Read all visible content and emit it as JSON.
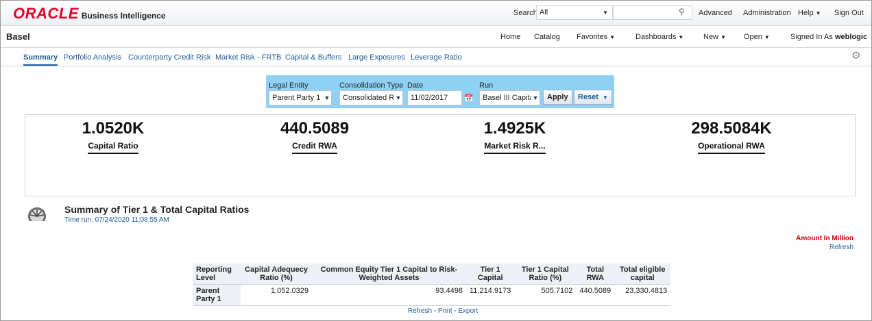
{
  "header": {
    "logo": "ORACLE",
    "product": "Business Intelligence",
    "search_label": "Search",
    "search_scope": "All",
    "search_value": "",
    "links": [
      "Advanced",
      "Administration",
      "Help",
      "Sign Out"
    ]
  },
  "nav": {
    "dashboard_title": "Basel",
    "items": [
      "Home",
      "Catalog",
      "Favorites",
      "Dashboards",
      "New",
      "Open"
    ],
    "signed_in_label": "Signed In As",
    "user": "weblogic"
  },
  "tabs": [
    "Summary",
    "Portfolio Analysis",
    "Counterparty Credit Risk",
    "Market Risk - FRTB",
    "Capital & Buffers",
    "Large Exposures",
    "Leverage Ratio"
  ],
  "active_tab": "Summary",
  "prompts": {
    "legal_entity": {
      "label": "Legal Entity",
      "value": "Parent Party 1"
    },
    "consolidation_type": {
      "label": "Consolidation Type",
      "value": "Consolidated R"
    },
    "date": {
      "label": "Date",
      "value": "11/02/2017"
    },
    "run": {
      "label": "Run",
      "value": "Basel III Capita"
    },
    "apply_label": "Apply",
    "reset_label": "Reset"
  },
  "kpis": [
    {
      "value": "1.0520K",
      "label": "Capital Ratio"
    },
    {
      "value": "440.5089",
      "label": "Credit RWA"
    },
    {
      "value": "1.4925K",
      "label": "Market Risk R..."
    },
    {
      "value": "298.5084K",
      "label": "Operational RWA"
    }
  ],
  "summary": {
    "title": "Summary of Tier 1 & Total Capital Ratios",
    "time_run": "Time run: 07/24/2020 11:08:55 AM",
    "amount_note": "Amount In Million",
    "refresh_label": "Refresh",
    "table": {
      "headers": [
        "Reporting Level",
        "Capital Adequecy Ratio (%)",
        "Common Equity Tier 1 Capital to Risk-Weighted Assets",
        "Tier 1 Capital",
        "Tier 1 Capital Ratio (%)",
        "Total RWA",
        "Total eligible capital"
      ],
      "rows": [
        [
          "Parent Party 1",
          "1,052.0329",
          "93.4498",
          "11,214.9173",
          "505.7102",
          "440.5089",
          "23,330.4813"
        ]
      ]
    },
    "footer_links": [
      "Refresh",
      "Print",
      "Export"
    ]
  },
  "colors": {
    "oracle_red": "#e4002b",
    "link_blue": "#1d5a9a",
    "prompt_bg": "#8fd0f4",
    "amount_red": "#cc0000"
  }
}
